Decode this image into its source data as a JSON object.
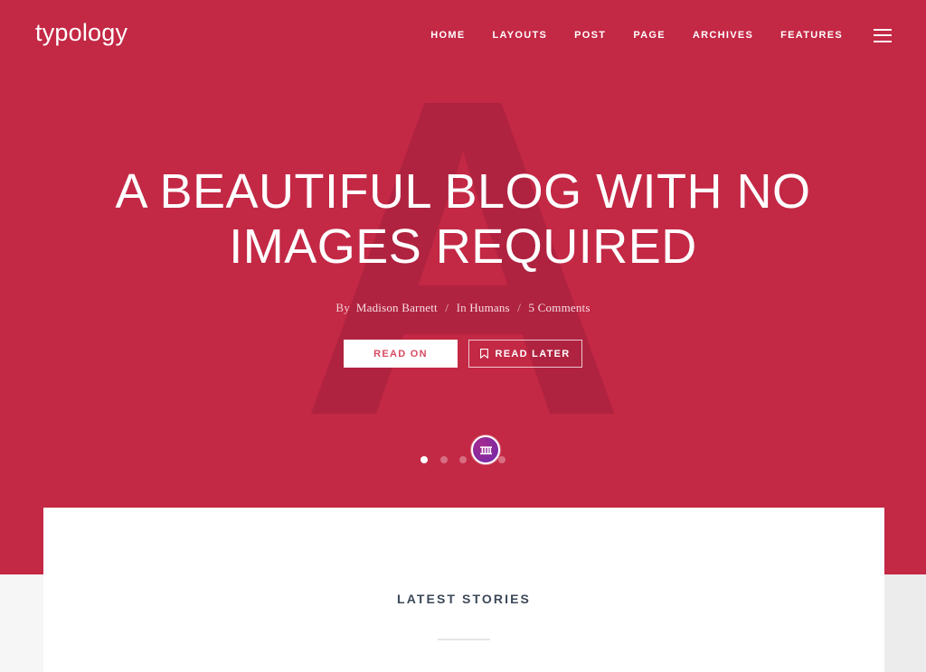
{
  "site": {
    "logo": "typology",
    "accent_color": "#c32845",
    "hero_background": "#c32845",
    "watermark_letter": "A",
    "watermark_color": "#b02340",
    "card_background": "#ffffff",
    "page_background": "#f2f2f2"
  },
  "nav": {
    "items": [
      {
        "label": "HOME"
      },
      {
        "label": "LAYOUTS"
      },
      {
        "label": "POST"
      },
      {
        "label": "PAGE"
      },
      {
        "label": "ARCHIVES"
      },
      {
        "label": "FEATURES"
      }
    ],
    "menu_icon": "hamburger-icon"
  },
  "hero": {
    "title": "A BEAUTIFUL BLOG WITH NO IMAGES REQUIRED",
    "meta": {
      "by_label": "By",
      "author": "Madison Barnett",
      "separator": "/",
      "category_label": "In",
      "category": "Humans",
      "comments": "5 Comments"
    },
    "buttons": {
      "primary": "READ ON",
      "secondary": "READ LATER",
      "secondary_icon": "bookmark-icon"
    }
  },
  "slider": {
    "dots": [
      {
        "active": true
      },
      {
        "active": false
      },
      {
        "active": false
      },
      {
        "active": false
      },
      {
        "active": false
      }
    ],
    "active_index": 0,
    "total": 5,
    "badge_icon": "columns-badge-icon",
    "badge_color": "#8e2a9a"
  },
  "main": {
    "section_title": "LATEST STORIES"
  }
}
